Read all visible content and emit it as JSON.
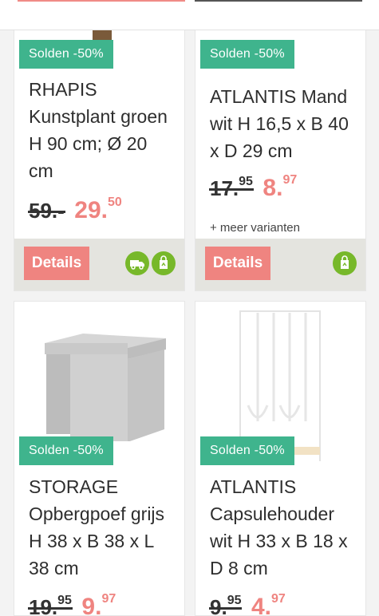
{
  "products": [
    {
      "badge": "Solden -50%",
      "title": "RHAPIS Kunstplant groen H 90 cm; Ø 20 cm",
      "price_old_main": "59.-",
      "price_old_cents": "",
      "price_new_main": "29.",
      "price_new_cents": "50",
      "details_label": "Details",
      "icons": [
        "delivery-truck-icon",
        "store-pickup-icon"
      ]
    },
    {
      "badge": "Solden -50%",
      "title": "ATLANTIS Mand wit H 16,5 x B 40 x D 29 cm",
      "price_old_main": "17.",
      "price_old_cents": "95",
      "price_new_main": "8.",
      "price_new_cents": "97",
      "variants": "+ meer varianten",
      "details_label": "Details",
      "icons": [
        "store-pickup-icon"
      ]
    },
    {
      "badge": "Solden -50%",
      "title": "STORAGE Opbergpoef grijs H 38 x B 38 x L 38 cm",
      "price_old_main": "19.",
      "price_old_cents": "95",
      "price_new_main": "9.",
      "price_new_cents": "97"
    },
    {
      "badge": "Solden -50%",
      "title": "ATLANTIS Capsulehouder wit H 33 x B 18 x D 8 cm",
      "price_old_main": "9.",
      "price_old_cents": "95",
      "price_new_main": "4.",
      "price_new_cents": "97"
    }
  ],
  "colors": {
    "badge": "#3fb48d",
    "price_sale": "#ef8480",
    "details_button": "#ef8480",
    "icon_green": "#77b82a",
    "action_bar": "#e4e4df"
  }
}
